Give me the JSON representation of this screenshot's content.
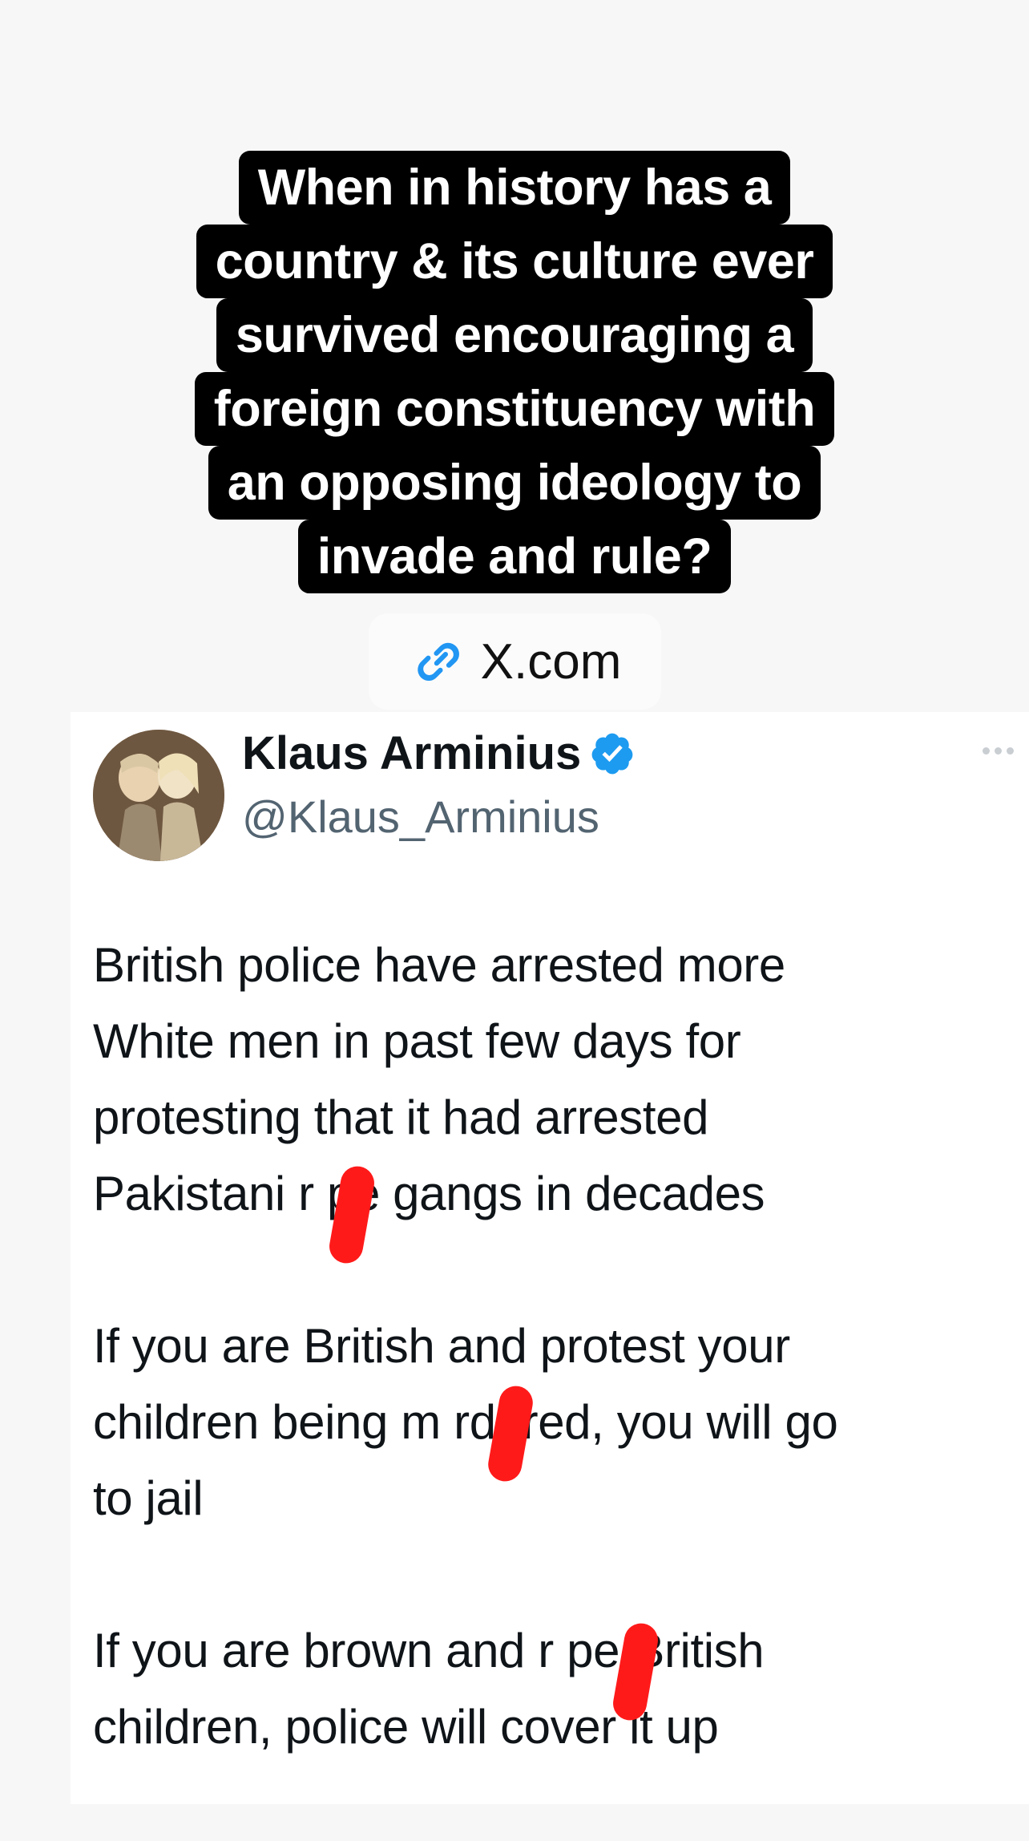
{
  "caption": {
    "lines": [
      "When in history has a",
      "country & its culture ever",
      "survived encouraging a",
      "foreign constituency with",
      "an opposing ideology to",
      "invade and rule?"
    ]
  },
  "link_chip": {
    "icon": "link-icon",
    "label": "X.com"
  },
  "tweet": {
    "author_name": "Klaus Arminius",
    "author_handle": "@Klaus_Arminius",
    "verified": true,
    "more_icon": "more-dots-icon",
    "paragraphs": [
      "British police have arrested more\nWhite men in past few days for\nprotesting that it had arrested\nPakistani r pe gangs in decades",
      "If you are British and protest your\nchildren being m rdered, you will go\nto jail",
      "If you are brown and r pe British\nchildren, police will cover it up"
    ]
  },
  "colors": {
    "caption_bg": "#000000",
    "caption_text": "#ffffff",
    "verified_blue": "#1d9bf0",
    "handle_gray": "#536471",
    "redaction_red": "#ff1a1a"
  }
}
